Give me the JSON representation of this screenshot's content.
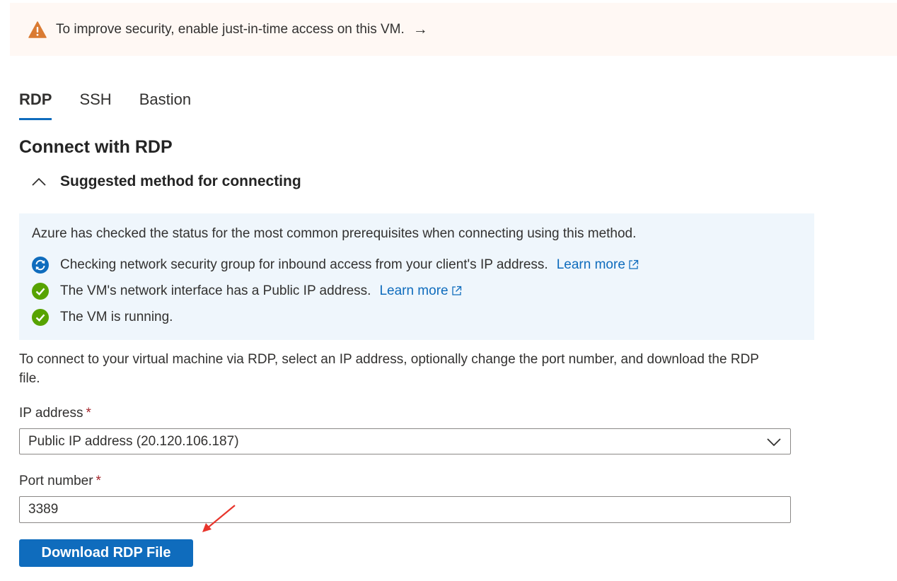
{
  "banner": {
    "message": "To improve security, enable just-in-time access on this VM.",
    "arrow": "→"
  },
  "tabs": [
    {
      "label": "RDP",
      "active": true
    },
    {
      "label": "SSH",
      "active": false
    },
    {
      "label": "Bastion",
      "active": false
    }
  ],
  "page_title": "Connect with RDP",
  "section": {
    "title": "Suggested method for connecting",
    "expanded": true,
    "intro": "Azure has checked the status for the most common prerequisites when connecting using this method.",
    "checks": [
      {
        "status": "in-progress",
        "text": "Checking network security group for inbound access from your client's IP address.",
        "link": "Learn more"
      },
      {
        "status": "passed",
        "text": "The VM's network interface has a Public IP address.",
        "link": "Learn more"
      },
      {
        "status": "passed",
        "text": "The VM is running.",
        "link": ""
      }
    ]
  },
  "description": "To connect to your virtual machine via RDP, select an IP address, optionally change the port number, and download the RDP file.",
  "ip_address": {
    "label": "IP address",
    "required_mark": "*",
    "selected": "Public IP address (20.120.106.187)"
  },
  "port": {
    "label": "Port number",
    "required_mark": "*",
    "value": "3389"
  },
  "download_button": "Download RDP File",
  "colors": {
    "accent": "#0f6cbd",
    "success": "#57a300",
    "warning": "#da7b33",
    "required": "#a4262c",
    "annotation": "#e8352c"
  },
  "icons": {
    "banner": "warning-triangle-icon",
    "expand": "chevron-up-icon",
    "check_in_progress": "refresh-icon",
    "check_passed": "checkmark-circle-icon",
    "external_link": "open-in-new-icon",
    "dropdown": "chevron-down-icon"
  }
}
